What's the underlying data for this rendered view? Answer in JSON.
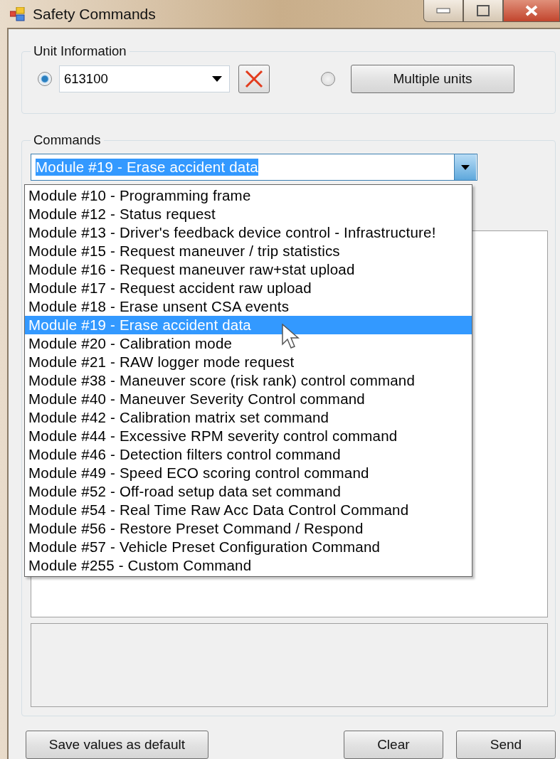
{
  "window": {
    "title": "Safety Commands"
  },
  "unit_information": {
    "label": "Unit Information",
    "single_unit": {
      "selected": true,
      "value": "613100"
    },
    "multiple_units": {
      "selected": false,
      "button": "Multiple units"
    }
  },
  "commands": {
    "label": "Commands",
    "value": "Module #19 - Erase accident data",
    "expanded": true,
    "options": [
      {
        "label": "Module #10 - Programming frame",
        "selected": false
      },
      {
        "label": "Module #12 - Status request",
        "selected": false
      },
      {
        "label": "Module #13 - Driver's feedback device control - Infrastructure!",
        "selected": false
      },
      {
        "label": "Module #15 - Request maneuver / trip statistics",
        "selected": false
      },
      {
        "label": "Module #16 - Request maneuver raw+stat upload",
        "selected": false
      },
      {
        "label": "Module #17 - Request accident raw upload",
        "selected": false
      },
      {
        "label": "Module #18 - Erase unsent CSA events",
        "selected": false
      },
      {
        "label": "Module #19 - Erase accident data",
        "selected": true
      },
      {
        "label": "Module #20 - Calibration mode",
        "selected": false
      },
      {
        "label": "Module #21 - RAW logger mode request",
        "selected": false
      },
      {
        "label": "Module #38 - Maneuver score (risk rank) control command",
        "selected": false
      },
      {
        "label": "Module #40 - Maneuver Severity Control command",
        "selected": false
      },
      {
        "label": "Module #42 - Calibration matrix set command",
        "selected": false
      },
      {
        "label": "Module #44 - Excessive RPM severity control command",
        "selected": false
      },
      {
        "label": "Module #46 - Detection filters control command",
        "selected": false
      },
      {
        "label": "Module #49 - Speed ECO scoring control command",
        "selected": false
      },
      {
        "label": "Module #52 - Off-road setup data set command",
        "selected": false
      },
      {
        "label": "Module #54 - Real Time Raw Acc Data Control Command",
        "selected": false
      },
      {
        "label": "Module #56 - Restore Preset Command / Respond",
        "selected": false
      },
      {
        "label": "Module #57 - Vehicle Preset Configuration Command",
        "selected": false
      },
      {
        "label": "Module #255 - Custom Command",
        "selected": false
      }
    ]
  },
  "buttons": [
    "Save values as default",
    "Clear",
    "Send"
  ]
}
